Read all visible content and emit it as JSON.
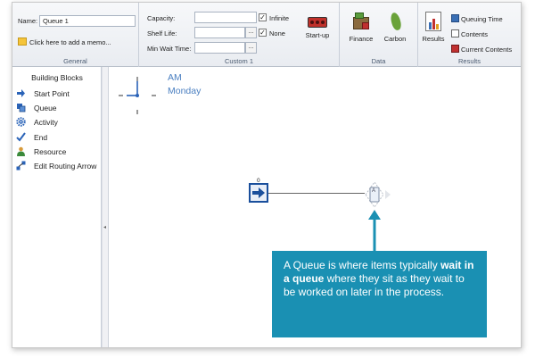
{
  "ribbon": {
    "general": {
      "name_label": "Name:",
      "name_value": "Queue 1",
      "memo_link": "Click here to add a memo...",
      "group_label": "General"
    },
    "custom": {
      "capacity_label": "Capacity:",
      "shelf_life_label": "Shelf Life:",
      "min_wait_label": "Min Wait Time:",
      "dots": "...",
      "infinite_label": "Infinite",
      "none_label": "None",
      "startup_label": "Start-up",
      "group_label": "Custom 1"
    },
    "data": {
      "finance_label": "Finance",
      "carbon_label": "Carbon",
      "group_label": "Data"
    },
    "results": {
      "results_label": "Results",
      "queuing_time_label": "Queuing Time",
      "contents_label": "Contents",
      "current_contents_label": "Current Contents",
      "group_label": "Results"
    }
  },
  "building_blocks": {
    "title": "Building Blocks",
    "items": [
      {
        "label": "Start Point",
        "icon": "arrow-right-icon"
      },
      {
        "label": "Queue",
        "icon": "queue-icon"
      },
      {
        "label": "Activity",
        "icon": "gear-icon"
      },
      {
        "label": "End",
        "icon": "checkmark-icon"
      },
      {
        "label": "Resource",
        "icon": "person-icon"
      },
      {
        "label": "Edit Routing Arrow",
        "icon": "routing-icon"
      }
    ]
  },
  "canvas": {
    "clock_ampm": "AM",
    "clock_day": "Monday",
    "start_point_count": "0",
    "queue_letter": "A"
  },
  "callout": {
    "text_before": "A Queue is where items typically ",
    "text_bold": "wait in a queue",
    "text_after": " where they sit as they wait to be worked on later in the process."
  },
  "colors": {
    "accent_blue": "#4a7fc1",
    "callout_bg": "#1a90b3"
  }
}
